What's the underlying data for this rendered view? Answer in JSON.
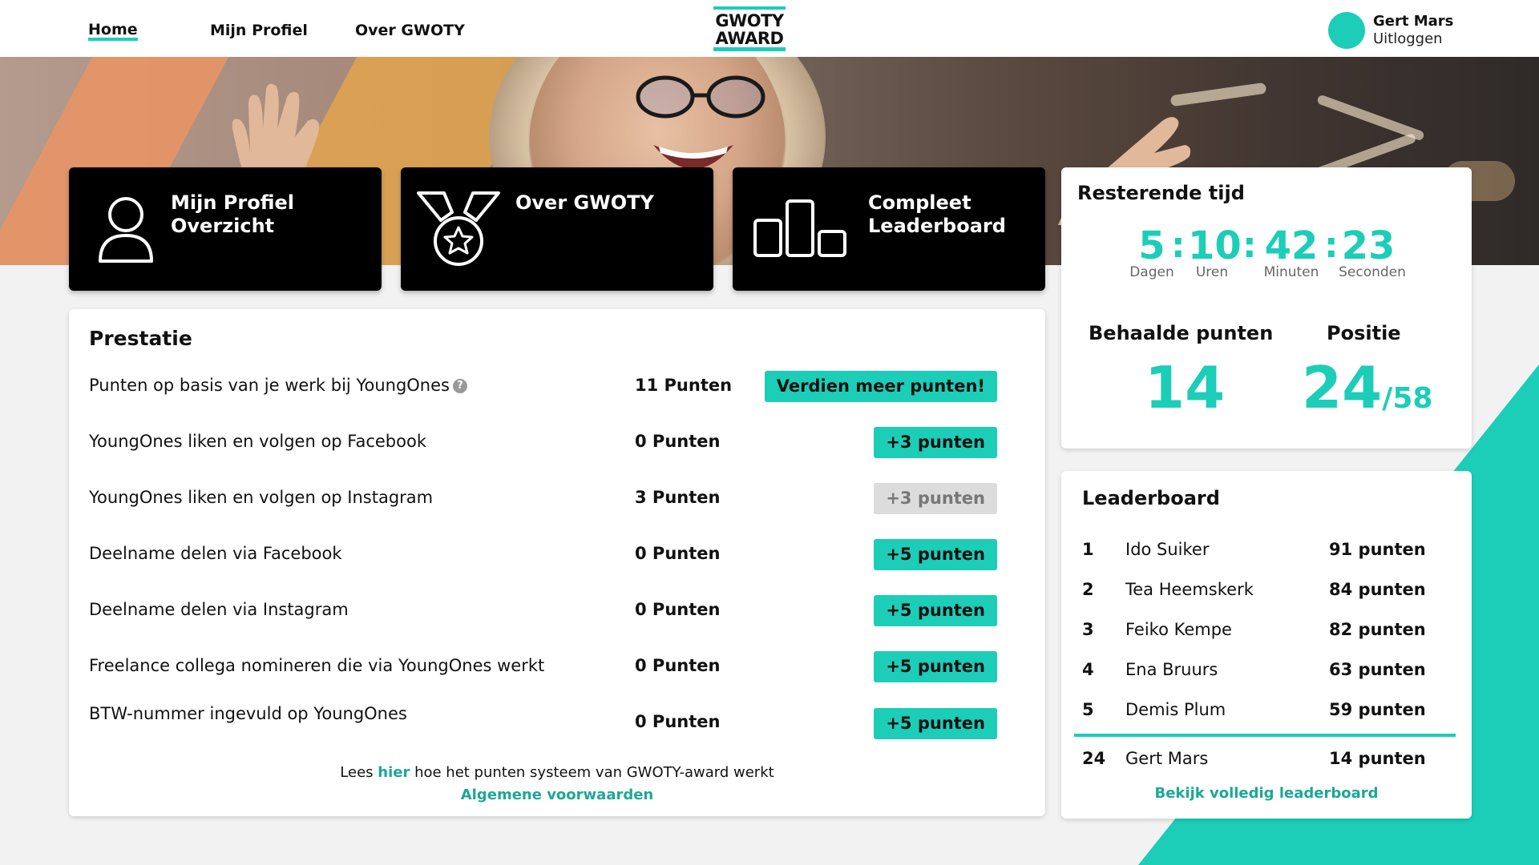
{
  "nav": {
    "links": [
      "Home",
      "Mijn Profiel",
      "Over GWOTY"
    ],
    "logo_line1": "GWOTY",
    "logo_line2": "AWARD",
    "user_name": "Gert Mars",
    "logout": "Uitloggen"
  },
  "tiles": [
    {
      "title_line1": "Mijn Profiel",
      "title_line2": "Overzicht",
      "icon": "user-icon"
    },
    {
      "title_line1": "Over GWOTY",
      "title_line2": "",
      "icon": "medal-icon"
    },
    {
      "title_line1": "Compleet",
      "title_line2": "Leaderboard",
      "icon": "podium-icon"
    }
  ],
  "timer": {
    "title": "Resterende tijd",
    "days": "5",
    "hours": "10",
    "minutes": "42",
    "seconds": "23",
    "sep": ":",
    "labels": [
      "Dagen",
      "Uren",
      "Minuten",
      "Seconden"
    ]
  },
  "stats": {
    "points_label": "Behaalde punten",
    "points": "14",
    "position_label": "Positie",
    "position": "24",
    "position_total": "/58"
  },
  "prestatie": {
    "title": "Prestatie",
    "rows": [
      {
        "label": "Punten op basis van je werk bij YoungOnes",
        "points": "11 Punten",
        "button": "Verdien meer punten!",
        "enabled": true,
        "help": "?"
      },
      {
        "label": "YoungOnes liken en volgen op Facebook",
        "points": "0 Punten",
        "button": "+3 punten",
        "enabled": true
      },
      {
        "label": "YoungOnes liken en volgen op Instagram",
        "points": "3 Punten",
        "button": "+3 punten",
        "enabled": false
      },
      {
        "label": "Deelname delen via Facebook",
        "points": "0 Punten",
        "button": "+5 punten",
        "enabled": true
      },
      {
        "label": "Deelname delen via Instagram",
        "points": "0 Punten",
        "button": "+5 punten",
        "enabled": true
      },
      {
        "label": "Freelance collega nomineren die via YoungOnes werkt",
        "points": "0 Punten",
        "button": "+5 punten",
        "enabled": true
      },
      {
        "label": "BTW-nummer ingevuld op YoungOnes",
        "points": "0 Punten",
        "button": "+5 punten",
        "enabled": true
      }
    ],
    "footer_pre": "Lees ",
    "footer_link": "hier",
    "footer_post": " hoe het punten systeem van GWOTY-award werkt",
    "terms": "Algemene voorwaarden"
  },
  "leaderboard": {
    "title": "Leaderboard",
    "entries": [
      {
        "rank": "1",
        "name": "Ido Suiker",
        "points": "91 punten"
      },
      {
        "rank": "2",
        "name": "Tea Heemskerk",
        "points": "84 punten"
      },
      {
        "rank": "3",
        "name": "Feiko Kempe",
        "points": "82 punten"
      },
      {
        "rank": "4",
        "name": "Ena Bruurs",
        "points": "63 punten"
      },
      {
        "rank": "5",
        "name": "Demis Plum",
        "points": "59 punten"
      }
    ],
    "self": {
      "rank": "24",
      "name": "Gert Mars",
      "points": "14 punten"
    },
    "link": "Bekijk volledig leaderboard"
  },
  "colors": {
    "accent": "#1ccdb8",
    "link": "#1ca895",
    "tile": "#000000",
    "disabled": "#dcdcdc"
  }
}
